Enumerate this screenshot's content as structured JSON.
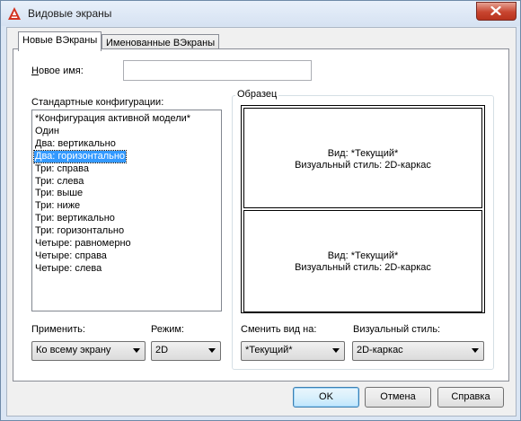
{
  "window": {
    "title": "Видовые экраны",
    "accent": "#c8452f"
  },
  "tabs": [
    {
      "label": "Новые ВЭкраны",
      "active": true
    },
    {
      "label": "Именованные ВЭкраны",
      "active": false
    }
  ],
  "new_name": {
    "label": "Новое имя:",
    "value": ""
  },
  "standard_configs": {
    "label": "Стандартные конфигурации:",
    "items": [
      "*Конфигурация активной модели*",
      "Один",
      "Два: вертикально",
      "Два: горизонтально",
      "Три: справа",
      "Три: слева",
      "Три: выше",
      "Три: ниже",
      "Три: вертикально",
      "Три: горизонтально",
      "Четыре: равномерно",
      "Четыре: справа",
      "Четыре: слева"
    ],
    "selected_index": 3
  },
  "preview": {
    "label": "Образец",
    "panes": [
      {
        "view": "Вид: *Текущий*",
        "style": "Визуальный стиль: 2D-каркас"
      },
      {
        "view": "Вид: *Текущий*",
        "style": "Визуальный стиль: 2D-каркас"
      }
    ]
  },
  "apply_to": {
    "label": "Применить:",
    "value": "Ко всему экрану"
  },
  "mode": {
    "label": "Режим:",
    "value": "2D"
  },
  "change_view": {
    "label": "Сменить вид на:",
    "value": "*Текущий*"
  },
  "visual_style": {
    "label": "Визуальный стиль:",
    "value": "2D-каркас"
  },
  "buttons": {
    "ok": "OK",
    "cancel": "Отмена",
    "help": "Справка"
  }
}
